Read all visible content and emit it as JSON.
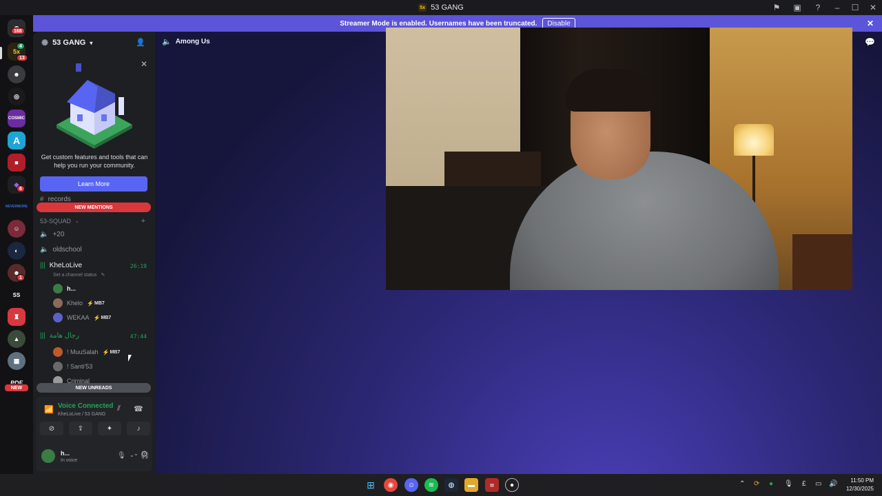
{
  "window": {
    "title": "53 GANG",
    "server_abbrev": "5x"
  },
  "banner": {
    "message": "Streamer Mode is enabled. Usernames have been truncated.",
    "disable_label": "Disable"
  },
  "guilds": {
    "dm_badge": "168",
    "server53_badge_a": "4",
    "server53_badge_b": "13",
    "cosmic_label": "COSMIC",
    "letter_a": "A",
    "badge_6": "6",
    "badge_1": "1",
    "ss_label": "SS",
    "new_label": "NEW",
    "neverwhere_label": "NEVERMORE"
  },
  "sidebar": {
    "server_name": "53 GANG",
    "promo_text": "Get custom features and tools that can help you run your community.",
    "learn_more": "Learn More",
    "records_channel": "records",
    "new_mentions": "NEW MENTIONS",
    "category": "53-SQUAD",
    "channels": [
      {
        "name": "+20"
      },
      {
        "name": "oldschool"
      },
      {
        "name": "KheLoLive",
        "timer": "26:19",
        "status": "Set a channel status"
      },
      {
        "name": "رجال هامة",
        "timer": "47:44"
      }
    ],
    "kheloLive_users": [
      {
        "name": "h...",
        "badge": ""
      },
      {
        "name": "Khelo",
        "badge": "MB7"
      },
      {
        "name": "WEKAA",
        "badge": "MB7"
      }
    ],
    "rijal_users": [
      {
        "name": "! MuuSalah",
        "badge": "MB7"
      },
      {
        "name": "! Santi'53",
        "badge": ""
      },
      {
        "name": "Criminal",
        "badge": ""
      }
    ],
    "new_unreads": "NEW UNREADS"
  },
  "voice_panel": {
    "status": "Voice Connected",
    "location": "KheLoLive / 53 GANG",
    "user_name": "h...",
    "user_status": "In voice"
  },
  "main": {
    "channel_title": "Among Us"
  },
  "taskbar": {
    "time": "11:50 PM",
    "date": "12/30/2025",
    "lang": "£"
  },
  "colors": {
    "accent": "#5865f2",
    "voice_green": "#23a55a",
    "mention_red": "#da373c",
    "banner": "#5c54d9"
  }
}
